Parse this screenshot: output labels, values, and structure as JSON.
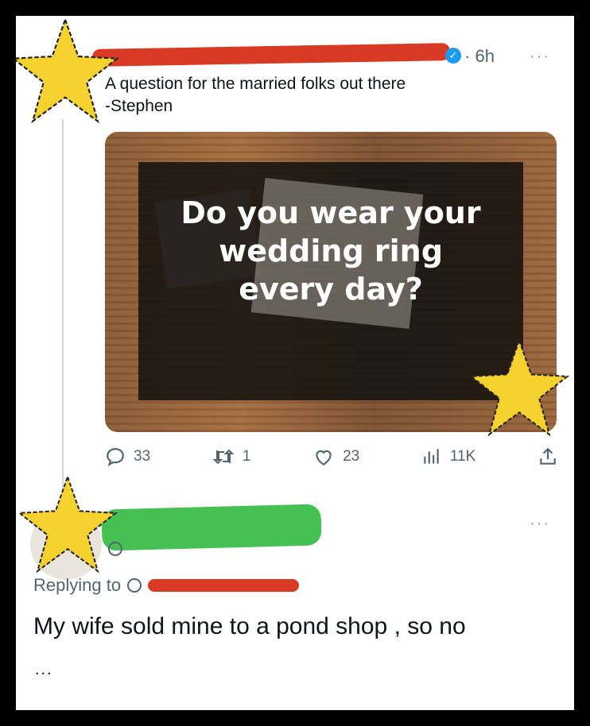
{
  "tweet": {
    "time": "6h",
    "text_line1": "A question for the married folks out there",
    "text_line2": "-Stephen",
    "media_text_lines": [
      "Do you wear your",
      "wedding ring",
      "every day?"
    ],
    "stats": {
      "replies": "33",
      "retweets": "1",
      "likes": "23",
      "views": "11K"
    }
  },
  "reply": {
    "replying_label": "Replying to",
    "text": "My wife sold mine to a pond shop , so no",
    "ellipsis": "..."
  },
  "colors": {
    "redact_red": "#d83a24",
    "redact_green": "#46c052",
    "verified_blue": "#1d9bf0",
    "star_yellow": "#f6d22e"
  },
  "icons": [
    "star-icon",
    "verified-badge-icon",
    "more-options-icon",
    "reply-icon",
    "retweet-icon",
    "like-icon",
    "views-icon",
    "share-icon"
  ]
}
